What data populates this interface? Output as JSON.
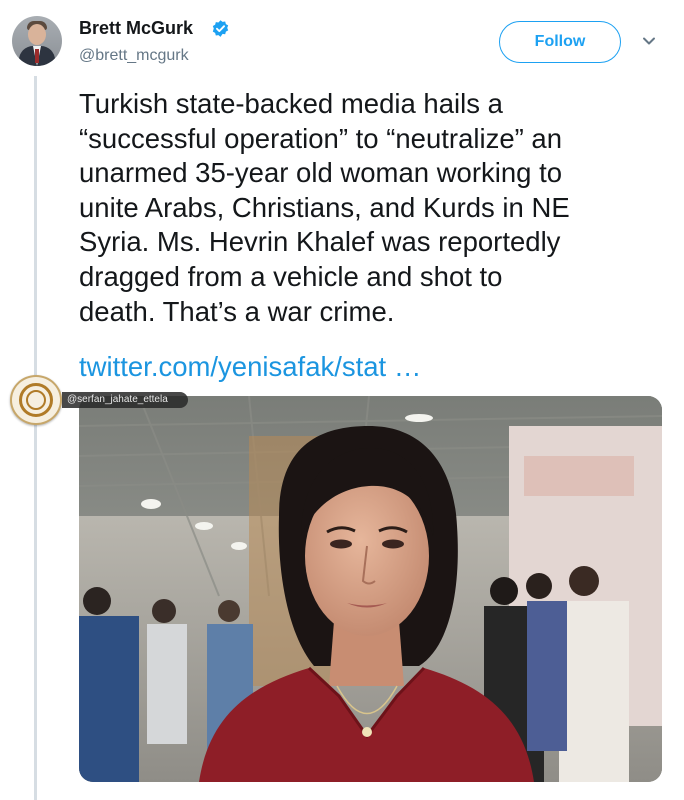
{
  "tweet": {
    "author_name": "Brett McGurk",
    "author_handle": "@brett_mcgurk",
    "follow_label": "Follow",
    "text_lines": [
      "Turkish state-backed media hails a",
      "“successful operation” to “neutralize” an",
      "unarmed 35-year old woman working to",
      "unite Arabs, Christians, and Kurds in NE",
      "Syria. Ms. Hevrin Khalef was reportedly",
      "dragged from a vehicle and shot to",
      "death. That’s a war crime."
    ],
    "link_text": "twitter.com/yenisafak/stat …"
  },
  "watermark": {
    "handle": "@serfan_jahate_ettela"
  },
  "icons": {
    "verified": "verified-badge-icon",
    "caret": "chevron-down-icon"
  },
  "colors": {
    "accent": "#1da1f2",
    "link": "#1b95e0",
    "text": "#14171a",
    "secondary": "#657786",
    "thread_line": "#d6dde3"
  }
}
